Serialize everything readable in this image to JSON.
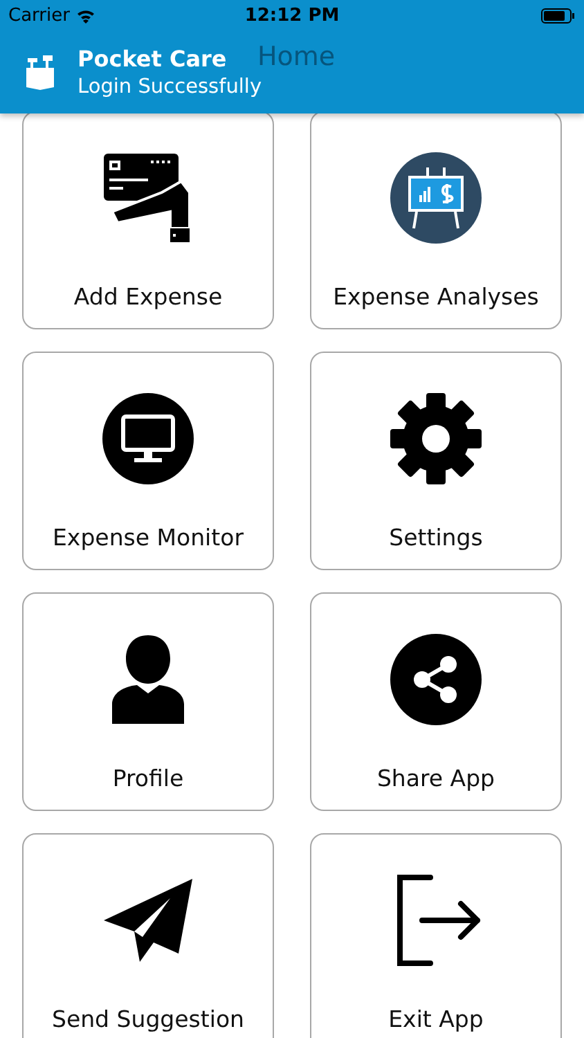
{
  "status_bar": {
    "carrier": "Carrier",
    "time": "12:12 PM"
  },
  "nav_bar": {
    "title": "Home"
  },
  "notification": {
    "title": "Pocket Care",
    "message": "Login Successfully"
  },
  "menu": [
    {
      "label": "Add Expense"
    },
    {
      "label": "Expense Analyses"
    },
    {
      "label": "Expense Monitor"
    },
    {
      "label": "Settings"
    },
    {
      "label": "Profile"
    },
    {
      "label": "Share App"
    },
    {
      "label": "Send Suggestion"
    },
    {
      "label": "Exit App"
    }
  ]
}
